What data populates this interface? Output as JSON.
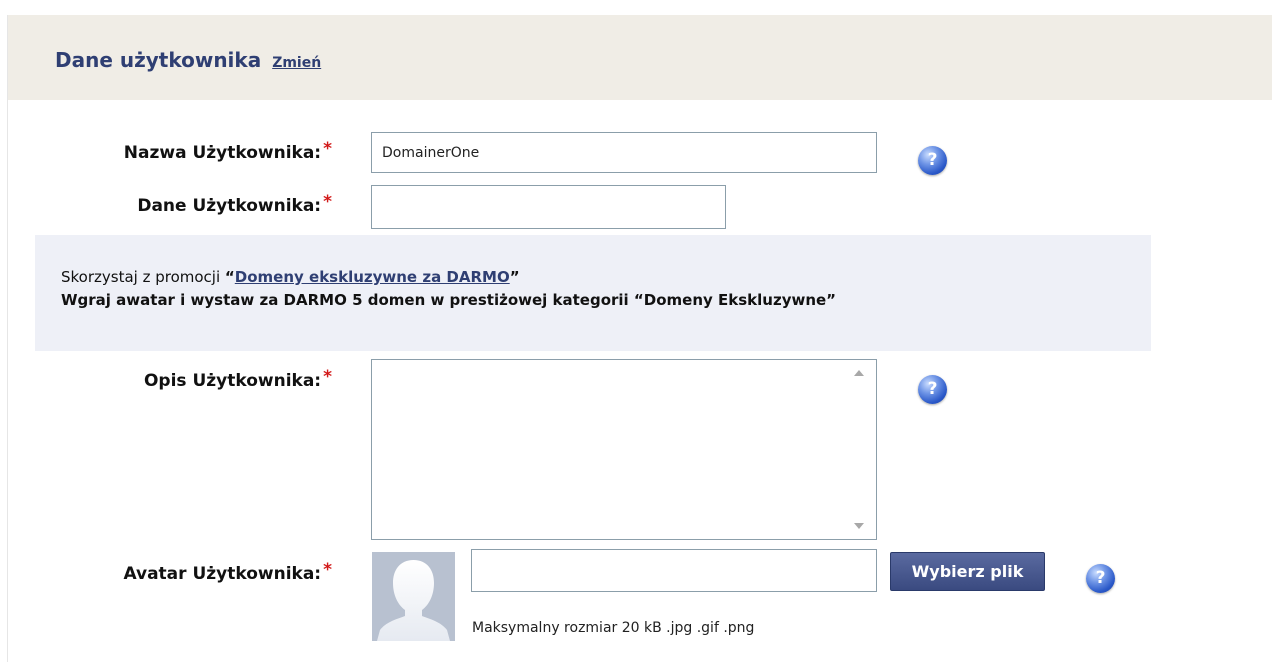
{
  "header": {
    "title": "Dane użytkownika",
    "change_link": "Zmień"
  },
  "form": {
    "username": {
      "label": "Nazwa Użytkownika:",
      "value": "DomainerOne"
    },
    "user_data": {
      "label": "Dane Użytkownika:",
      "value": ""
    },
    "promo": {
      "prefix": "Skorzystaj z promocji ",
      "open_quote": "“",
      "link": "Domeny ekskluzywne za DARMO",
      "close_quote": "”",
      "line2": "Wgraj awatar i wystaw za DARMO 5 domen w prestiżowej kategorii “Domeny Ekskluzywne”"
    },
    "description": {
      "label": "Opis Użytkownika:",
      "value": ""
    },
    "avatar": {
      "label": "Avatar Użytkownika:",
      "file_value": "",
      "button_label": "Wybierz plik",
      "hint": "Maksymalny rozmiar 20 kB .jpg .gif .png"
    },
    "required_mark": "*",
    "help_glyph": "?"
  },
  "icons": {
    "help": "question-mark-icon",
    "avatar": "user-silhouette-icon"
  },
  "colors": {
    "accent": "#2f3f73",
    "required": "#d21a1a",
    "header_bg": "#f0ede6",
    "promo_bg": "#eef0f7"
  }
}
